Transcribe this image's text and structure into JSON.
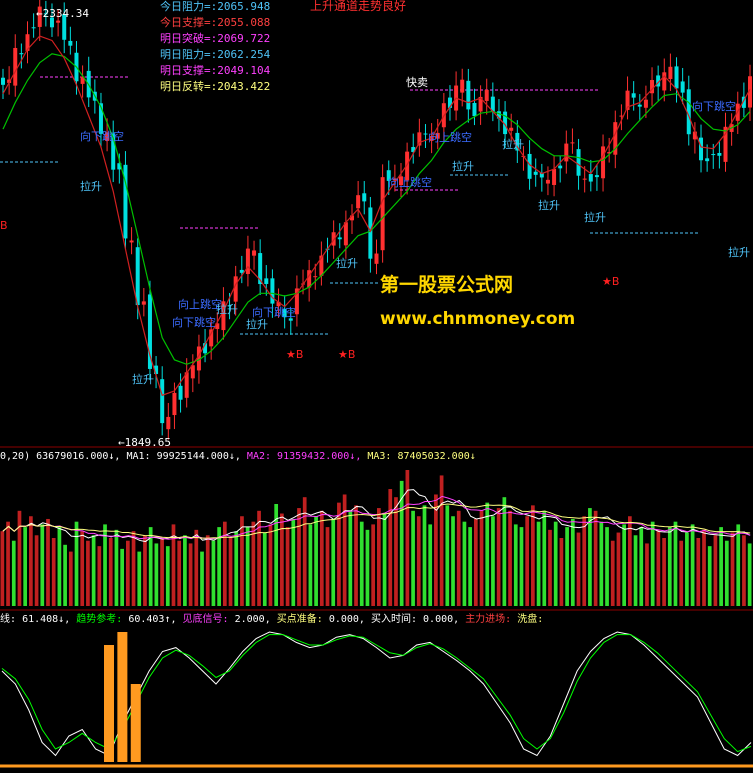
{
  "chart_data": [
    {
      "type": "candlestick",
      "panel": "price",
      "title": "",
      "levels": [
        {
          "label": "今日阻力",
          "value": "2065.948",
          "color": "#4fc3f7"
        },
        {
          "label": "今日支撑",
          "value": "2055.088",
          "color": "#ff4040"
        },
        {
          "label": "明日突破",
          "value": "2069.722",
          "color": "#ff40ff"
        },
        {
          "label": "明日阻力",
          "value": "2062.254",
          "color": "#4fc3f7"
        },
        {
          "label": "明日支撑",
          "value": "2049.104",
          "color": "#ff40ff"
        },
        {
          "label": "明日反转",
          "value": "2043.422",
          "color": "#ffff80"
        }
      ],
      "headline": "上升通道走势良好",
      "high_marker": "2334.34",
      "low_marker": "1849.65",
      "signals": {
        "up_gap": "向上跳空",
        "down_gap": "向下跳空",
        "pull_up": "拉升",
        "quick_sell": "快卖",
        "buy_mark": "B",
        "buy_star": "★"
      },
      "close_trend": [
        2250,
        2290,
        2310,
        2334,
        2320,
        2295,
        2260,
        2230,
        2200,
        2150,
        2080,
        2000,
        1930,
        1870,
        1900,
        1930,
        1950,
        1980,
        2000,
        2040,
        2060,
        2030,
        2000,
        1990,
        2020,
        2040,
        2060,
        2080,
        2100,
        2120,
        2060,
        2140,
        2150,
        2170,
        2200,
        2190,
        2230,
        2250,
        2220,
        2240,
        2215,
        2200,
        2170,
        2150,
        2140,
        2160,
        2180,
        2150,
        2140,
        2180,
        2210,
        2240,
        2230,
        2250,
        2270,
        2240,
        2200,
        2160,
        2175,
        2200,
        2230,
        2260
      ],
      "ma_fast": [
        2240,
        2265,
        2290,
        2305,
        2300,
        2280,
        2250,
        2215,
        2180,
        2130,
        2065,
        2000,
        1945,
        1900,
        1905,
        1925,
        1945,
        1970,
        1995,
        2025,
        2045,
        2030,
        2010,
        2000,
        2015,
        2035,
        2055,
        2075,
        2095,
        2110,
        2085,
        2120,
        2140,
        2160,
        2185,
        2190,
        2215,
        2235,
        2230,
        2235,
        2220,
        2205,
        2180,
        2160,
        2150,
        2155,
        2170,
        2160,
        2150,
        2170,
        2195,
        2225,
        2230,
        2245,
        2260,
        2245,
        2215,
        2180,
        2178,
        2195,
        2220,
        2245
      ],
      "ma_slow": [
        2200,
        2230,
        2255,
        2275,
        2285,
        2282,
        2270,
        2250,
        2225,
        2190,
        2140,
        2080,
        2020,
        1965,
        1940,
        1935,
        1940,
        1950,
        1965,
        1985,
        2005,
        2015,
        2015,
        2012,
        2015,
        2022,
        2035,
        2050,
        2065,
        2080,
        2085,
        2100,
        2115,
        2130,
        2150,
        2165,
        2185,
        2200,
        2210,
        2218,
        2220,
        2215,
        2205,
        2190,
        2178,
        2170,
        2170,
        2168,
        2163,
        2165,
        2178,
        2195,
        2210,
        2225,
        2238,
        2240,
        2230,
        2212,
        2200,
        2198,
        2205,
        2220
      ]
    },
    {
      "type": "bar",
      "panel": "volume",
      "header_prefix": "0,20)",
      "header_value": "63679016.000↓,",
      "ma_labels": [
        {
          "name": "MA1:",
          "value": "99925144.000↓,",
          "color": "#ffffff"
        },
        {
          "name": "MA2:",
          "value": "91359432.000↓,",
          "color": "#ff40ff"
        },
        {
          "name": "MA3:",
          "value": "87405032.000↓",
          "color": "#ffff80"
        }
      ],
      "values": [
        55,
        62,
        48,
        70,
        58,
        66,
        52,
        60,
        64,
        50,
        58,
        45,
        40,
        62,
        55,
        48,
        52,
        44,
        60,
        50,
        56,
        42,
        48,
        55,
        40,
        52,
        58,
        46,
        50,
        44,
        60,
        48,
        52,
        46,
        56,
        40,
        52,
        48,
        58,
        62,
        50,
        55,
        66,
        58,
        62,
        70,
        54,
        60,
        75,
        68,
        58,
        64,
        72,
        80,
        60,
        66,
        70,
        58,
        64,
        76,
        82,
        70,
        74,
        62,
        56,
        60,
        72,
        68,
        86,
        80,
        92,
        100,
        70,
        66,
        74,
        60,
        82,
        96,
        74,
        66,
        70,
        62,
        58,
        64,
        70,
        76,
        66,
        72,
        80,
        70,
        60,
        58,
        66,
        74,
        62,
        70,
        56,
        62,
        50,
        58,
        64,
        54,
        66,
        72,
        70,
        62,
        58,
        48,
        54,
        60,
        66,
        52,
        58,
        46,
        62,
        56,
        50,
        58,
        62,
        48,
        54,
        60,
        50,
        56,
        44,
        52,
        58,
        48,
        54,
        60,
        52,
        46
      ],
      "up": [
        1,
        1,
        0,
        1,
        0,
        1,
        1,
        0,
        1,
        1,
        0,
        0,
        1,
        0,
        1,
        1,
        0,
        1,
        0,
        1,
        0,
        0,
        1,
        1,
        0,
        1,
        0,
        0,
        1,
        0,
        1,
        1,
        0,
        1,
        1,
        0,
        1,
        0,
        0,
        1,
        1,
        0,
        1,
        0,
        1,
        1,
        0,
        1,
        0,
        1,
        1,
        0,
        1,
        1,
        0,
        0,
        1,
        1,
        0,
        1,
        1,
        0,
        1,
        0,
        0,
        1,
        1,
        0,
        1,
        1,
        0,
        1,
        0,
        1,
        0,
        0,
        1,
        1,
        0,
        0,
        1,
        0,
        0,
        1,
        1,
        0,
        0,
        1,
        0,
        1,
        0,
        0,
        1,
        1,
        0,
        0,
        1,
        0,
        1,
        0,
        0,
        1,
        1,
        0,
        1,
        0,
        0,
        1,
        1,
        0,
        1,
        0,
        0,
        1,
        0,
        1,
        1,
        0,
        0,
        1,
        0,
        0,
        1,
        1,
        0,
        1,
        0,
        0,
        1,
        0,
        1,
        0
      ]
    },
    {
      "type": "line",
      "panel": "indicator",
      "header_prefix": "线:",
      "header_items": [
        {
          "label": "61.408↓,",
          "color": "#ffffff"
        },
        {
          "label": "趋势参考:",
          "color": "#00ff00"
        },
        {
          "label": "60.403↑,",
          "color": "#ffffff"
        },
        {
          "label": "见底信号:",
          "color": "#ff40ff"
        },
        {
          "label": "2.000,",
          "color": "#ffffff"
        },
        {
          "label": "买点准备:",
          "color": "#ffff80"
        },
        {
          "label": "0.000,",
          "color": "#ffffff"
        },
        {
          "label": "买入时间:",
          "color": "#ffffff"
        },
        {
          "label": "0.000,",
          "color": "#ffffff"
        },
        {
          "label": "主力进场:",
          "color": "#ff4040"
        },
        {
          "label": "洗盘:",
          "color": "#ffff80"
        }
      ],
      "series": [
        {
          "name": "线",
          "color": "#ffffff",
          "values": [
            70,
            60,
            40,
            15,
            5,
            20,
            25,
            10,
            5,
            30,
            50,
            70,
            85,
            88,
            80,
            70,
            60,
            72,
            85,
            95,
            100,
            98,
            92,
            88,
            90,
            96,
            98,
            95,
            88,
            80,
            82,
            90,
            92,
            85,
            78,
            70,
            60,
            45,
            30,
            10,
            5,
            20,
            45,
            70,
            85,
            95,
            100,
            98,
            90,
            80,
            70,
            60,
            50,
            30,
            10,
            5,
            15
          ]
        },
        {
          "name": "趋势参考",
          "color": "#00ff00",
          "values": [
            72,
            64,
            48,
            25,
            10,
            15,
            22,
            15,
            10,
            25,
            45,
            65,
            80,
            86,
            82,
            74,
            65,
            70,
            82,
            92,
            98,
            98,
            94,
            90,
            90,
            94,
            97,
            96,
            90,
            84,
            82,
            88,
            91,
            87,
            80,
            72,
            64,
            50,
            36,
            18,
            10,
            18,
            38,
            62,
            80,
            92,
            98,
            98,
            92,
            84,
            74,
            64,
            54,
            36,
            18,
            8,
            12
          ]
        }
      ],
      "bars": [
        0,
        0,
        0,
        0,
        0,
        0,
        0,
        0,
        90,
        100,
        60,
        0,
        0,
        0,
        0,
        0,
        0,
        0,
        0,
        0,
        0,
        0,
        0,
        0,
        0,
        0,
        0,
        0,
        0,
        0,
        0,
        0,
        0,
        0,
        0,
        0,
        0,
        0,
        0,
        0,
        0,
        0,
        0,
        0,
        0,
        0,
        0,
        0,
        0,
        0,
        0,
        0,
        0,
        0,
        0,
        0,
        0
      ]
    }
  ],
  "watermark": {
    "line1": "第一股票公式网",
    "line2": "www.chnmoney.com"
  }
}
